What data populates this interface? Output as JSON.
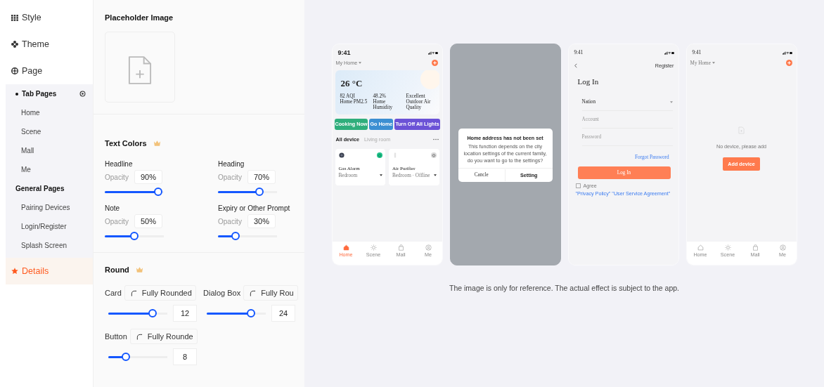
{
  "sidebar": {
    "items": [
      {
        "label": "Style",
        "selected": false
      },
      {
        "label": "Theme",
        "selected": false
      },
      {
        "label": "Page",
        "selected": false,
        "expanded": true,
        "groups": [
          {
            "label": "Tab Pages",
            "children": [
              {
                "label": "Home",
                "selected": false
              },
              {
                "label": "Scene",
                "selected": false
              },
              {
                "label": "Mall",
                "selected": false
              },
              {
                "label": "Me",
                "selected": false
              }
            ]
          },
          {
            "label": "General Pages",
            "children": [
              {
                "label": "Pairing Devices",
                "selected": false
              },
              {
                "label": "Login/Register",
                "selected": false
              },
              {
                "label": "Splash Screen",
                "selected": false
              }
            ]
          }
        ]
      },
      {
        "label": "Details",
        "selected": true
      }
    ]
  },
  "settings": {
    "placeholder_image": {
      "title": "Placeholder Image"
    },
    "text_colors": {
      "title": "Text Colors",
      "items": [
        {
          "label": "Headline",
          "opacity_label": "Opacity",
          "value": "90%",
          "level": 0.9
        },
        {
          "label": "Heading",
          "opacity_label": "Opacity",
          "value": "70%",
          "level": 0.7
        },
        {
          "label": "Note",
          "opacity_label": "Opacity",
          "value": "50%",
          "level": 0.5
        },
        {
          "label": "Expiry or Other Prompt",
          "opacity_label": "Opacity",
          "value": "30%",
          "level": 0.3
        }
      ]
    },
    "round": {
      "title": "Round",
      "items": [
        {
          "label": "Card",
          "mode": "Fully Rounded",
          "value": "12",
          "level": 0.75
        },
        {
          "label": "Dialog Box",
          "mode": "Fully Rou",
          "value": "24",
          "level": 0.75
        },
        {
          "label": "Button",
          "mode": "Fully Rounde",
          "value": "8",
          "level": 0.3
        }
      ]
    }
  },
  "preview": {
    "screens": [
      {
        "kind": "home",
        "time": "9:41",
        "home_label": "My Home",
        "temperature": "26 °C",
        "stats": [
          {
            "value": "82 AQI",
            "label": "Home PM2.5"
          },
          {
            "value": "48.2%",
            "label": "Home Humidity"
          },
          {
            "value": "Excellent",
            "label": "Outdoor Air Quality"
          }
        ],
        "scenes": [
          {
            "label": "Cooking Now",
            "color": "#2fae7c"
          },
          {
            "label": "Go Home",
            "color": "#3b8fd2"
          },
          {
            "label": "Turn Off All Lights",
            "color": "#6b52d6"
          }
        ],
        "tabs": [
          {
            "label": "All device",
            "selected": true
          },
          {
            "label": "Living room",
            "selected": false
          }
        ],
        "devices": [
          {
            "name": "Gas Alarm",
            "room": "Bedroom",
            "on": true
          },
          {
            "name": "Air Purifier",
            "room": "Bedroom · Offline",
            "on": false
          }
        ],
        "nav": [
          {
            "label": "Home",
            "selected": true
          },
          {
            "label": "Scene",
            "selected": false
          },
          {
            "label": "Mall",
            "selected": false
          },
          {
            "label": "Me",
            "selected": false
          }
        ]
      },
      {
        "kind": "dialog",
        "title": "Home address has not been set",
        "message": "This function depends on the city location settings of the current family, do you want to go to the settings?",
        "buttons": [
          "Cancle",
          "Setting"
        ]
      },
      {
        "kind": "login",
        "time": "9:41",
        "action": "Register",
        "title": "Log In",
        "select": "Nation",
        "placeholders": [
          "Account",
          "Password"
        ],
        "link": "Forgot Password",
        "button": "Log In",
        "agree": "Agree",
        "agree_links": "\"Privacy Policy\" \"User Service Agreement\"",
        "checked": false
      },
      {
        "kind": "empty",
        "time": "9:41",
        "home_label": "My Home",
        "message": "No device, please add",
        "button": "Add device",
        "nav": [
          {
            "label": "Home",
            "selected": false
          },
          {
            "label": "Scene",
            "selected": false
          },
          {
            "label": "Mall",
            "selected": false
          },
          {
            "label": "Me",
            "selected": false
          }
        ]
      }
    ],
    "caption": "The image is only for reference. The actual effect is subject to the app."
  }
}
